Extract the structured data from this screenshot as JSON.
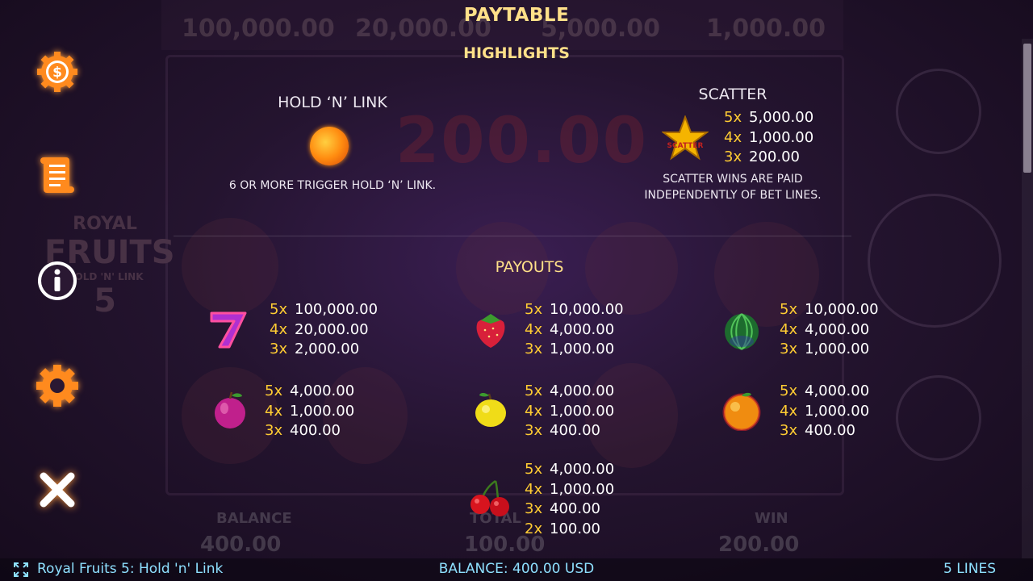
{
  "header": {
    "title": "PAYTABLE",
    "subtitle": "HIGHLIGHTS"
  },
  "menu": [
    {
      "name": "coin-icon"
    },
    {
      "name": "scroll-icon"
    },
    {
      "name": "info-icon"
    },
    {
      "name": "gear-icon"
    },
    {
      "name": "close-icon"
    }
  ],
  "hold_n_link": {
    "title": "HOLD ‘N’ LINK",
    "description": "6 OR MORE TRIGGER HOLD ‘N’ LINK."
  },
  "scatter": {
    "title": "SCATTER",
    "icon_label": "SCATTER",
    "pays": [
      {
        "mult": "5x",
        "value": "5,000.00"
      },
      {
        "mult": "4x",
        "value": "1,000.00"
      },
      {
        "mult": "3x",
        "value": "200.00"
      }
    ],
    "description_line1": "SCATTER WINS ARE PAID",
    "description_line2": "INDEPENDENTLY OF BET LINES."
  },
  "payouts": {
    "title": "PAYOUTS",
    "symbols": [
      {
        "symbol": "seven-icon",
        "pays": [
          {
            "mult": "5x",
            "value": "100,000.00"
          },
          {
            "mult": "4x",
            "value": "20,000.00"
          },
          {
            "mult": "3x",
            "value": "2,000.00"
          }
        ]
      },
      {
        "symbol": "strawberry-icon",
        "pays": [
          {
            "mult": "5x",
            "value": "10,000.00"
          },
          {
            "mult": "4x",
            "value": "4,000.00"
          },
          {
            "mult": "3x",
            "value": "1,000.00"
          }
        ]
      },
      {
        "symbol": "watermelon-icon",
        "pays": [
          {
            "mult": "5x",
            "value": "10,000.00"
          },
          {
            "mult": "4x",
            "value": "4,000.00"
          },
          {
            "mult": "3x",
            "value": "1,000.00"
          }
        ]
      },
      {
        "symbol": "plum-icon",
        "pays": [
          {
            "mult": "5x",
            "value": "4,000.00"
          },
          {
            "mult": "4x",
            "value": "1,000.00"
          },
          {
            "mult": "3x",
            "value": "400.00"
          }
        ]
      },
      {
        "symbol": "lemon-icon",
        "pays": [
          {
            "mult": "5x",
            "value": "4,000.00"
          },
          {
            "mult": "4x",
            "value": "1,000.00"
          },
          {
            "mult": "3x",
            "value": "400.00"
          }
        ]
      },
      {
        "symbol": "orange-icon",
        "pays": [
          {
            "mult": "5x",
            "value": "4,000.00"
          },
          {
            "mult": "4x",
            "value": "1,000.00"
          },
          {
            "mult": "3x",
            "value": "400.00"
          }
        ]
      },
      {
        "symbol": "cherries-icon",
        "pays": [
          {
            "mult": "5x",
            "value": "4,000.00"
          },
          {
            "mult": "4x",
            "value": "1,000.00"
          },
          {
            "mult": "3x",
            "value": "400.00"
          },
          {
            "mult": "2x",
            "value": "100.00"
          }
        ]
      }
    ]
  },
  "bottom_bar": {
    "game_name": "Royal Fruits 5: Hold 'n' Link",
    "balance": "BALANCE: 400.00 USD",
    "lines": "5 LINES"
  },
  "background": {
    "top_values": [
      "100,000.00",
      "20,000.00",
      "5,000.00",
      "1,000.00"
    ],
    "big_win": "200.00",
    "balance_label": "BALANCE",
    "balance_value": "400.00",
    "total_label": "TOTAL",
    "total_value": "100.00",
    "win_label": "WIN",
    "win_value": "200.00",
    "currency": "USD",
    "logo_royal": "ROYAL",
    "logo_fruits": "FRUITS",
    "logo_sub": "HOLD 'N' LINK",
    "logo_num": "5"
  },
  "colors": {
    "accent_gold": "#ffe089",
    "multiplier": "#ffcc33",
    "menu_orange": "#ff8a1e",
    "bottom_text": "#8ee0ff"
  }
}
